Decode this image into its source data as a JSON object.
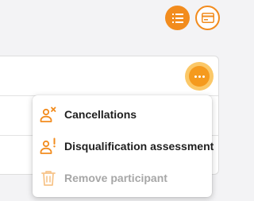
{
  "header": {
    "list_view_icon": "list-icon",
    "card_view_icon": "card-icon"
  },
  "row_actions": {
    "more_icon": "more-horizontal-icon"
  },
  "menu": {
    "items": [
      {
        "label": "Cancellations",
        "icon": "person-cancel-icon",
        "enabled": true
      },
      {
        "label": "Disqualification assessment",
        "icon": "person-alert-icon",
        "enabled": true
      },
      {
        "label": "Remove participant",
        "icon": "trash-icon",
        "enabled": false
      }
    ]
  },
  "colors": {
    "accent": "#f28c1e",
    "accent_light": "#fbc868",
    "disabled_text": "#a7a7a7",
    "background": "#f3f3f5"
  }
}
